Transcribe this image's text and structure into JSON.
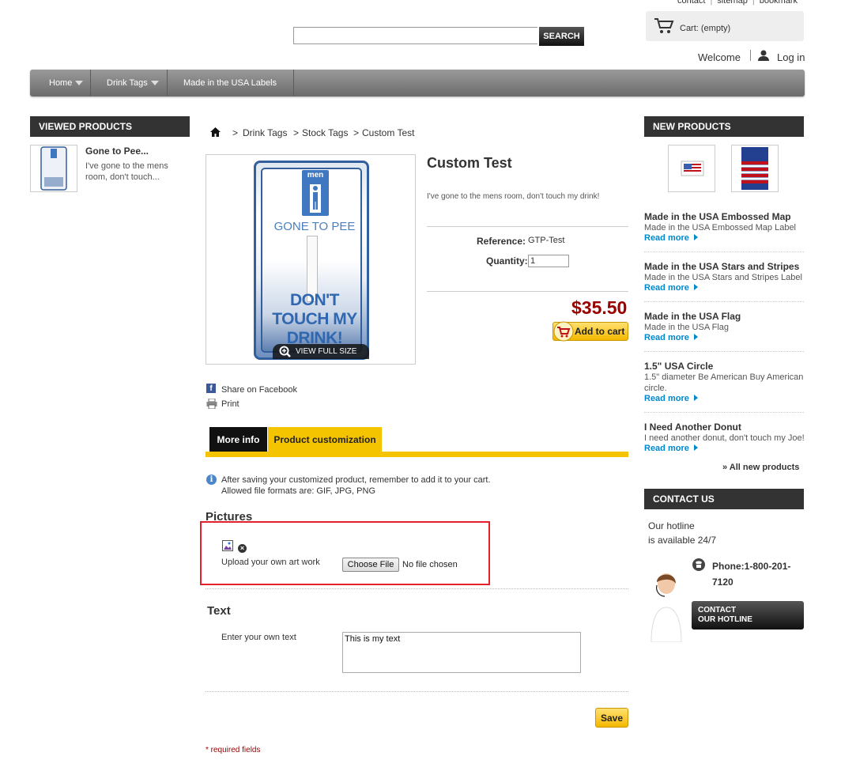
{
  "header": {
    "top_links": [
      "contact",
      "sitemap",
      "bookmark"
    ],
    "search_placeholder": "",
    "search_button": "SEARCH",
    "cart_label": "Cart: (empty)",
    "welcome": "Welcome",
    "login": "Log in"
  },
  "nav": [
    {
      "label": "Home",
      "has_dropdown": true
    },
    {
      "label": "Drink Tags",
      "has_dropdown": true
    },
    {
      "label": "Made in the USA Labels",
      "has_dropdown": false
    }
  ],
  "viewed": {
    "title": "VIEWED PRODUCTS",
    "items": [
      {
        "name": "Gone to Pee...",
        "desc": "I've gone to the mens room, don't touch..."
      }
    ]
  },
  "breadcrumb": [
    "Drink Tags",
    "Stock Tags",
    "Custom Test"
  ],
  "breadcrumb_seps": [
    ">",
    ">",
    ">"
  ],
  "product": {
    "image_text": {
      "badge": "men",
      "line1": "GONE TO PEE",
      "line2": "DON'T TOUCH MY DRINK!"
    },
    "view_full": "VIEW FULL SIZE",
    "title": "Custom Test",
    "short_desc": "I've gone to the mens room, don't touch my drink!",
    "reference_label": "Reference:",
    "reference_value": "GTP-Test",
    "quantity_label": "Quantity:",
    "quantity_value": "1",
    "price": "$35.50",
    "add_to_cart": "Add to cart",
    "share_facebook": "Share on Facebook",
    "print": "Print"
  },
  "tabs": [
    {
      "label": "More info",
      "active": false
    },
    {
      "label": "Product customization",
      "active": true
    }
  ],
  "customization": {
    "info_line1": "After saving your customized product, remember to add it to your cart.",
    "info_line2": "Allowed file formats are: GIF, JPG, PNG",
    "pictures_heading": "Pictures",
    "upload_label": "Upload your own art work",
    "choose_file": "Choose File",
    "no_file": "No file chosen",
    "text_heading": "Text",
    "text_label": "Enter your own text",
    "text_value": "This is my text",
    "save": "Save",
    "required": "* required fields"
  },
  "new_products": {
    "title": "NEW PRODUCTS",
    "items": [
      {
        "name": "Made in the USA Embossed Map",
        "desc": "Made in the USA Embossed Map Label",
        "more": "Read more"
      },
      {
        "name": "Made in the USA Stars and Stripes",
        "desc": "Made in the USA Stars and Stripes Label",
        "more": "Read more"
      },
      {
        "name": "Made in the USA Flag",
        "desc": "Made in the USA Flag",
        "more": "Read more"
      },
      {
        "name": "1.5\" USA Circle",
        "desc": "1.5\" diameter Be American Buy American circle.",
        "more": "Read more"
      },
      {
        "name": "I Need Another Donut",
        "desc": "I need another donut, don't touch my Joe!",
        "more": "Read more"
      }
    ],
    "all_link": "» All new products"
  },
  "contact": {
    "title": "CONTACT US",
    "hotline_line1": "Our hotline",
    "hotline_line2": "is available 24/7",
    "phone": "Phone:1-800-201-7120",
    "button_line1": "CONTACT",
    "button_line2": "OUR HOTLINE"
  },
  "colors": {
    "accent": "#f5c400",
    "price": "#990000",
    "link": "#0088cc",
    "highlight": "#e3202c"
  }
}
